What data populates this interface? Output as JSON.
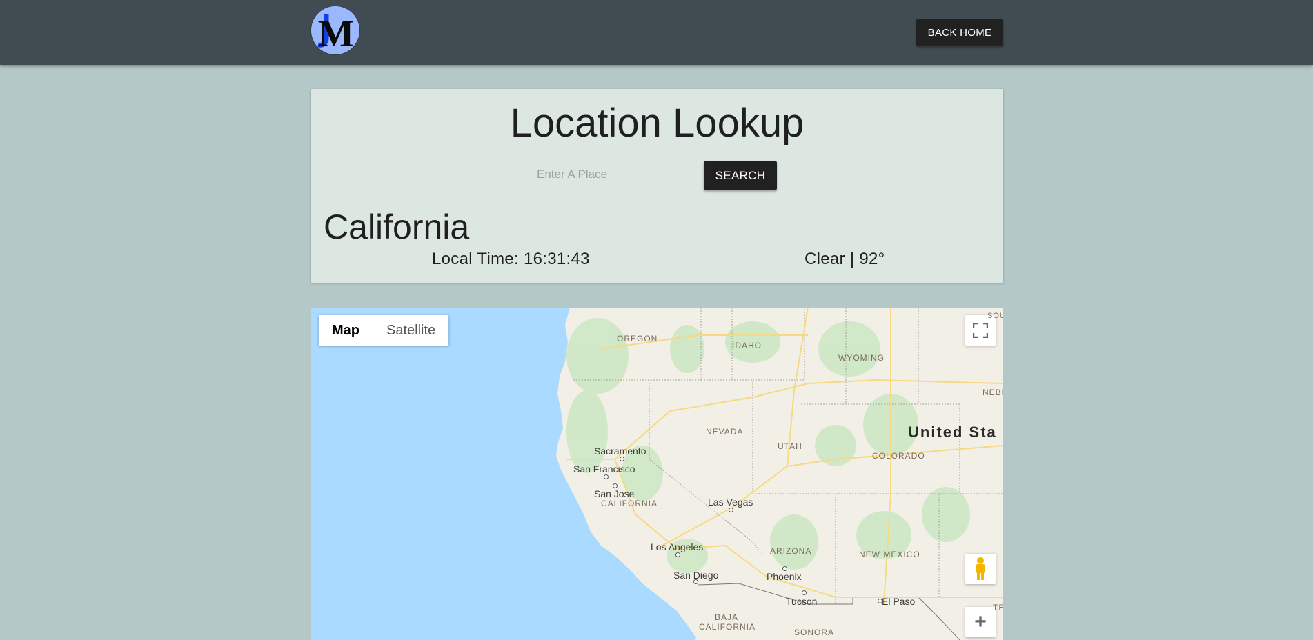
{
  "nav": {
    "logo_letter": "M",
    "back_home_label": "BACK HOME"
  },
  "lookup": {
    "title": "Location Lookup",
    "search_placeholder": "Enter A Place",
    "search_value": "",
    "search_label": "SEARCH",
    "place_name": "California",
    "local_time": "Local Time: 16:31:43",
    "weather": "Clear | 92°"
  },
  "map": {
    "type_options": [
      "Map",
      "Satellite"
    ],
    "selected_type": "Map",
    "zoom_in_label": "+",
    "country_label": "United Sta",
    "state_labels": [
      "OREGON",
      "IDAHO",
      "WYOMING",
      "NEBR",
      "NEVADA",
      "UTAH",
      "COLORADO",
      "CALIFORNIA",
      "ARIZONA",
      "NEW MEXICO",
      "BAJA CALIFORNIA",
      "SONORA",
      "SOUTH",
      "TE"
    ],
    "cities": [
      "Sacramento",
      "San Francisco",
      "San Jose",
      "Las Vegas",
      "Los Angeles",
      "San Diego",
      "Phoenix",
      "Tucson",
      "El Paso"
    ],
    "colors": {
      "water": "#aadaff",
      "land": "#f2efe6",
      "green": "#cde8c4",
      "highway": "#f7d983"
    }
  }
}
